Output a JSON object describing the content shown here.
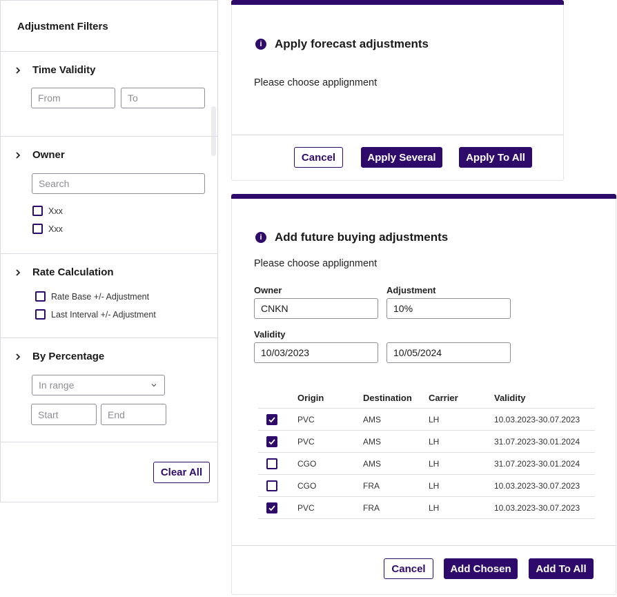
{
  "filters": {
    "title": "Adjustment Filters",
    "time_validity": {
      "title": "Time Validity",
      "from_placeholder": "From",
      "to_placeholder": "To"
    },
    "owner": {
      "title": "Owner",
      "search_placeholder": "Search",
      "options": [
        "Xxx",
        "Xxx"
      ]
    },
    "rate_calculation": {
      "title": "Rate Calculation",
      "options": [
        "Rate Base +/- Adjustment",
        "Last Interval +/- Adjustment"
      ]
    },
    "by_percentage": {
      "title": "By Percentage",
      "select_value": "In range",
      "start_placeholder": "Start",
      "end_placeholder": "End"
    },
    "clear_all_label": "Clear All"
  },
  "forecast_modal": {
    "title": "Apply forecast adjustments",
    "text": "Please choose applignment",
    "cancel_label": "Cancel",
    "apply_several_label": "Apply Several",
    "apply_all_label": "Apply To All"
  },
  "buying_modal": {
    "title": "Add future buying adjustments",
    "text": "Please choose applignment",
    "owner_label": "Owner",
    "owner_value": "CNKN",
    "adjustment_label": "Adjustment",
    "adjustment_value": "10%",
    "validity_label": "Validity",
    "validity_from": "10/03/2023",
    "validity_to": "10/05/2024",
    "table": {
      "headers": [
        "Origin",
        "Destination",
        "Carrier",
        "Validity"
      ],
      "rows": [
        {
          "checked": true,
          "origin": "PVC",
          "destination": "AMS",
          "carrier": "LH",
          "validity": "10.03.2023-30.07.2023"
        },
        {
          "checked": true,
          "origin": "PVC",
          "destination": "AMS",
          "carrier": "LH",
          "validity": "31.07.2023-30.01.2024"
        },
        {
          "checked": false,
          "origin": "CGO",
          "destination": "AMS",
          "carrier": "LH",
          "validity": "31.07.2023-30.01.2024"
        },
        {
          "checked": false,
          "origin": "CGO",
          "destination": "FRA",
          "carrier": "LH",
          "validity": "10.03.2023-30.07.2023"
        },
        {
          "checked": true,
          "origin": "PVC",
          "destination": "FRA",
          "carrier": "LH",
          "validity": "10.03.2023-30.07.2023"
        }
      ]
    },
    "cancel_label": "Cancel",
    "add_chosen_label": "Add Chosen",
    "add_all_label": "Add To All"
  },
  "colors": {
    "accent": "#2e0a6b",
    "border": "#d9d9df"
  },
  "icons": [
    "chevron-right-icon",
    "chevron-down-icon",
    "info-icon",
    "checkmark-icon"
  ]
}
